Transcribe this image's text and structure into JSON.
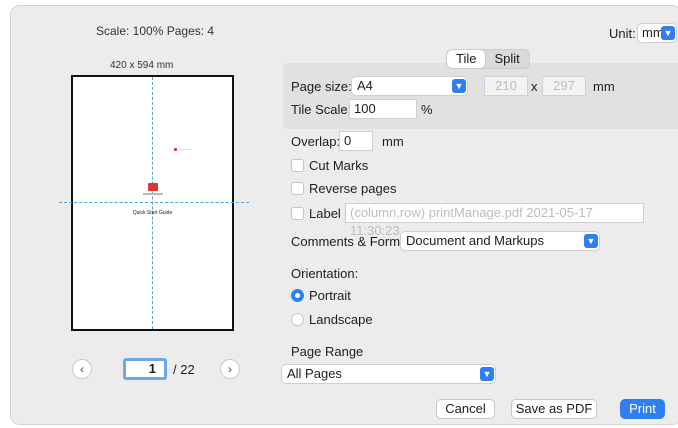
{
  "preview": {
    "scale_text": "Scale: 100%   Pages: 4",
    "paper_size": "420 x 594 mm",
    "doc_title": "Quick Start Guide",
    "prev_icon": "chevron-left-icon",
    "next_icon": "chevron-right-icon",
    "current_page": "1",
    "total_pages": "/ 22"
  },
  "unit": {
    "label": "Unit:",
    "value": "mm"
  },
  "tabs": [
    {
      "label": "Tile",
      "active": true
    },
    {
      "label": "Split",
      "active": false
    }
  ],
  "tile": {
    "page_size_label": "Page size:",
    "page_size_value": "A4",
    "width": "210",
    "x_label": "x",
    "height": "297",
    "size_unit": "mm",
    "tile_scale_label": "Tile Scale:",
    "tile_scale_value": "100",
    "tile_scale_unit": "%"
  },
  "overlap": {
    "label": "Overlap:",
    "value": "0",
    "unit": "mm"
  },
  "options": {
    "cut_marks": "Cut Marks",
    "reverse_pages": "Reverse pages",
    "label": "Label",
    "label_placeholder": "(column,row) printManage.pdf 2021-05-17 11:30:23"
  },
  "comments": {
    "label": "Comments & Forms:",
    "value": "Document and Markups"
  },
  "orientation": {
    "label": "Orientation:",
    "portrait": "Portrait",
    "landscape": "Landscape"
  },
  "page_range": {
    "label": "Page Range",
    "value": "All Pages"
  },
  "buttons": {
    "cancel": "Cancel",
    "save_pdf": "Save as PDF",
    "print": "Print"
  },
  "colors": {
    "accent": "#2f7ff0",
    "guide": "#4aa6d6"
  }
}
